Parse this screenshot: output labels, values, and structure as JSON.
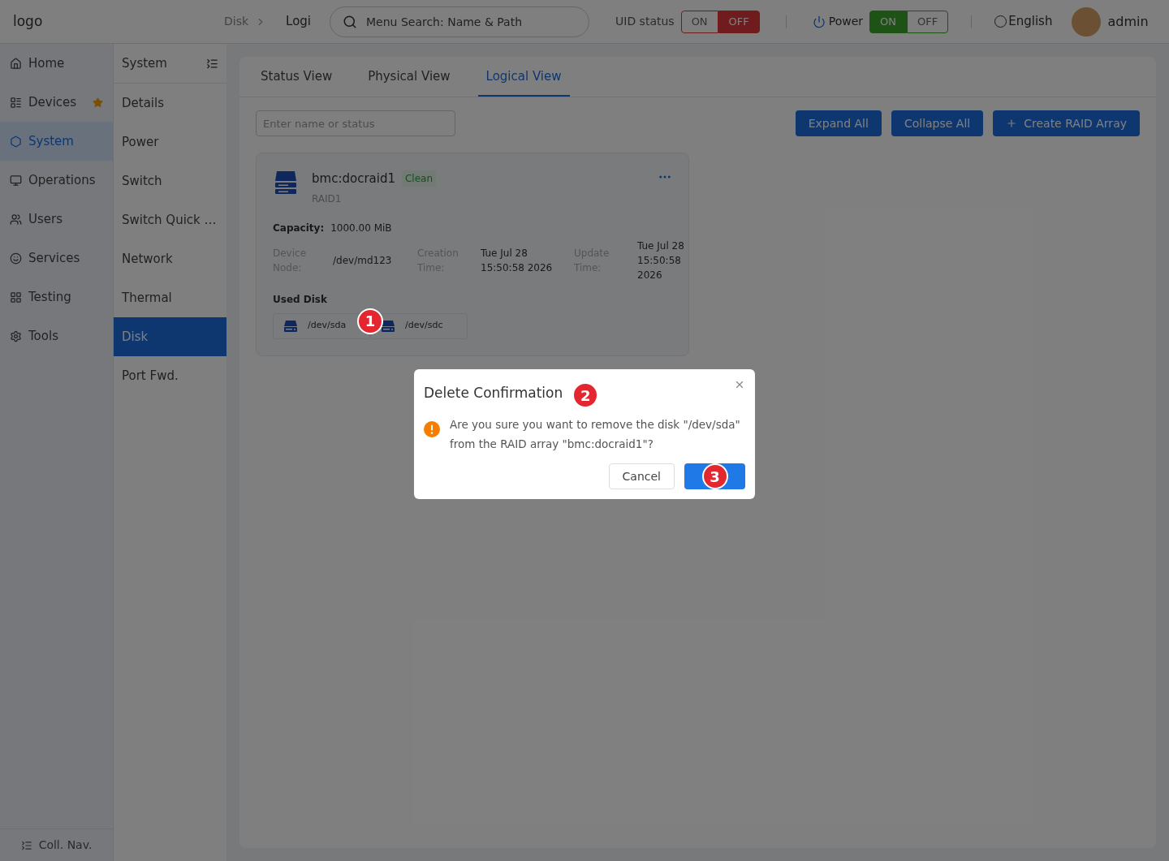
{
  "header": {
    "logo_alt": "logo",
    "breadcrumb": [
      "Disk",
      "Logi"
    ],
    "search": {
      "placeholder": "Menu Search: Name & Path"
    },
    "uid_status": {
      "label": "UID status",
      "options": [
        {
          "label": "ON",
          "selected": false
        },
        {
          "label": "OFF",
          "selected": true
        }
      ]
    },
    "power": {
      "label": "Power",
      "options": [
        {
          "label": "ON",
          "selected": true
        },
        {
          "label": "OFF",
          "selected": false
        }
      ]
    },
    "language": "English",
    "user": "admin"
  },
  "nav": [
    {
      "label": "Home",
      "selected": false,
      "starred": false
    },
    {
      "label": "Devices",
      "selected": false,
      "starred": true
    },
    {
      "label": "System",
      "selected": true,
      "starred": false
    },
    {
      "label": "Operations",
      "selected": false,
      "starred": false
    },
    {
      "label": "Users",
      "selected": false,
      "starred": false
    },
    {
      "label": "Services",
      "selected": false,
      "starred": false
    },
    {
      "label": "Testing",
      "selected": false,
      "starred": false
    },
    {
      "label": "Tools",
      "selected": false,
      "starred": false
    }
  ],
  "collapse_nav": "Coll. Nav.",
  "submenu": {
    "title": "System",
    "items": [
      {
        "label": "Details",
        "selected": false
      },
      {
        "label": "Power",
        "selected": false
      },
      {
        "label": "Switch",
        "selected": false
      },
      {
        "label": "Switch Quick …",
        "selected": false
      },
      {
        "label": "Network",
        "selected": false
      },
      {
        "label": "Thermal",
        "selected": false
      },
      {
        "label": "Disk",
        "selected": true
      },
      {
        "label": "Port Fwd.",
        "selected": false
      }
    ]
  },
  "tabs": [
    {
      "label": "Status View",
      "selected": false
    },
    {
      "label": "Physical View",
      "selected": false
    },
    {
      "label": "Logical View",
      "selected": true
    }
  ],
  "filter": {
    "placeholder": "Enter name or status"
  },
  "buttons": [
    {
      "label": "Expand All",
      "kind": "plain"
    },
    {
      "label": "Collapse All",
      "kind": "plain"
    },
    {
      "label": "Create RAID Array",
      "kind": "add"
    }
  ],
  "array": {
    "name": "bmc:docraid1",
    "status": "Clean",
    "level": "RAID1",
    "capacity_label": "Capacity:",
    "capacity": "1000.00 MiB",
    "fields": [
      {
        "label": "Device Node:",
        "value": "/dev/md123"
      },
      {
        "label": "Creation Time:",
        "value": "Tue Jul 28 15:50:58 2026"
      },
      {
        "label": "Update Time:",
        "value": "Tue Jul 28 15:50:58 2026"
      }
    ],
    "used_disk_label": "Used Disk",
    "disks": [
      "/dev/sda",
      "/dev/sdc"
    ]
  },
  "dialog": {
    "title": "Delete Confirmation",
    "message": "Are you sure you want to remove the disk \"/dev/sda\" from the RAID array \"bmc:docraid1\"?",
    "cancel": "Cancel"
  },
  "annotations": [
    "1",
    "2",
    "3"
  ]
}
